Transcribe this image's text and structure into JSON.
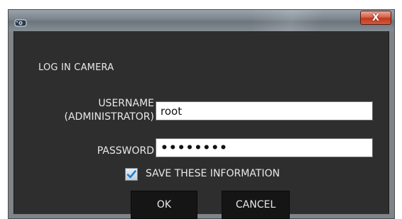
{
  "dialog": {
    "close_label": "X",
    "heading": "LOG IN CAMERA"
  },
  "form": {
    "username_label_line1": "USERNAME",
    "username_label_line2": "(ADMINISTRATOR)",
    "username_value": "root",
    "password_label": "PASSWORD",
    "password_value": "password",
    "save_info_label": "SAVE THESE INFORMATION",
    "save_info_checked": true
  },
  "buttons": {
    "ok": "OK",
    "cancel": "CANCEL"
  },
  "icons": {
    "app": "camera-icon",
    "close": "close-icon",
    "check": "check-icon"
  },
  "colors": {
    "dialog_background": "#2e2e2e",
    "button_background": "#151515",
    "close_button": "#c0391f",
    "checkmark": "#1c7fd6",
    "text": "#e8e8e8"
  }
}
